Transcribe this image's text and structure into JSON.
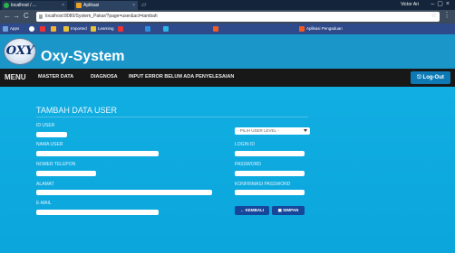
{
  "browser": {
    "tabs": [
      {
        "label": "localhost / ..."
      },
      {
        "label": "Aplikasi"
      }
    ],
    "window_user": "Victor Ari",
    "url": "localhost:8080/System_Pakar/?page=user&act=tambah",
    "bookmarks": [
      "Apps",
      "",
      "",
      "Imported",
      "Learning",
      "",
      "",
      "",
      "",
      "Aplikasi Pengaduan"
    ]
  },
  "app": {
    "title": "Oxy-System",
    "logo_text": "OXY",
    "nav": {
      "menu_label": "MENU",
      "items": [
        "MASTER DATA",
        "DIAGNOSA",
        "INPUT ERROR BELUM ADA PENYELESAIAN"
      ],
      "logout_label": "Log-Out"
    }
  },
  "form": {
    "title": "TAMBAH DATA USER",
    "left": {
      "id_user_label": "ID USER",
      "nama_user_label": "NAMA USER",
      "telepon_label": "NOMER TELEPON",
      "alamat_label": "ALAMAT",
      "email_label": "E-MAIL"
    },
    "right": {
      "level_placeholder": "- PILIH USER LEVEL -",
      "login_id_label": "LOGIN ID",
      "password_label": "PASSWORD",
      "konfirmasi_label": "KONFIRMASI PASSWORD"
    },
    "buttons": {
      "kembali": "KEMBALI",
      "simpan": "SIMPAN"
    }
  },
  "colors": {
    "content_bg": "#0aa6dc",
    "header_bg": "#1b96c8",
    "navbar_bg": "#181818",
    "button_bg": "#16469a"
  }
}
